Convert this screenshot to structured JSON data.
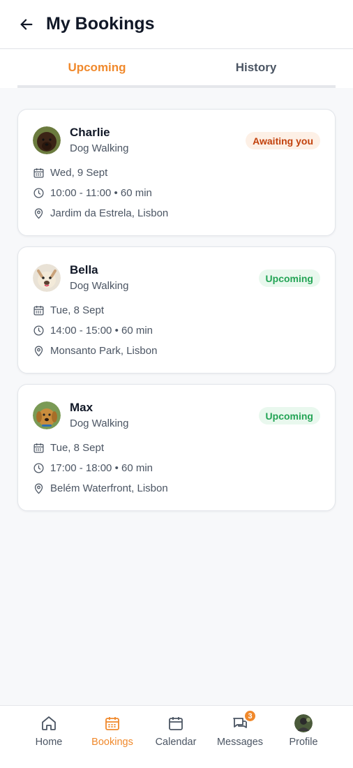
{
  "header": {
    "title": "My Bookings"
  },
  "tabs": [
    {
      "label": "Upcoming",
      "active": true
    },
    {
      "label": "History",
      "active": false
    }
  ],
  "bookings": [
    {
      "pet": "Charlie",
      "service": "Dog Walking",
      "status": "Awaiting you",
      "date": "Wed, 9 Sept",
      "time": "10:00 - 11:00 • 60 min",
      "location": "Jardim da Estrela, Lisbon"
    },
    {
      "pet": "Bella",
      "service": "Dog Walking",
      "status": "Upcoming",
      "date": "Tue, 8 Sept",
      "time": "14:00 - 15:00 • 60 min",
      "location": "Monsanto Park, Lisbon"
    },
    {
      "pet": "Max",
      "service": "Dog Walking",
      "status": "Upcoming",
      "date": "Tue, 8 Sept",
      "time": "17:00 - 18:00 • 60 min",
      "location": "Belém Waterfront, Lisbon"
    }
  ],
  "nav": {
    "items": [
      {
        "label": "Home",
        "icon": "home-icon"
      },
      {
        "label": "Bookings",
        "icon": "bookings-icon",
        "active": true
      },
      {
        "label": "Calendar",
        "icon": "calendar-icon"
      },
      {
        "label": "Messages",
        "icon": "messages-icon",
        "badge": "3"
      },
      {
        "label": "Profile",
        "icon": "profile-avatar"
      }
    ]
  },
  "colors": {
    "accent": "#f0892c",
    "awaiting_text": "#c2410c",
    "awaiting_bg": "#fdf0e6",
    "upcoming_text": "#23a455",
    "upcoming_bg": "#e9f8ee"
  }
}
